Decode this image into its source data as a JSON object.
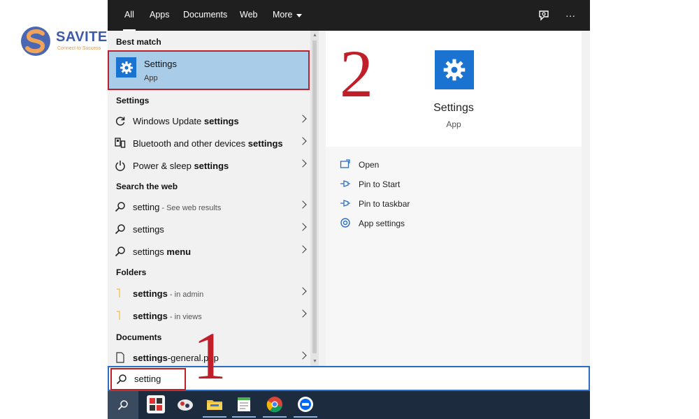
{
  "watermark": {
    "brand": "SAVITEL",
    "tagline": "Connect to Success"
  },
  "topbar": {
    "tabs": [
      {
        "label": "All",
        "active": true
      },
      {
        "label": "Apps",
        "active": false
      },
      {
        "label": "Documents",
        "active": false
      },
      {
        "label": "Web",
        "active": false
      },
      {
        "label": "More",
        "active": false
      }
    ],
    "more_dots": "···"
  },
  "left_pane": {
    "best_match_header": "Best match",
    "best_match": {
      "title": "Settings",
      "subtitle": "App"
    },
    "settings_header": "Settings",
    "settings_items": [
      {
        "prefix": "Windows Update ",
        "bold": "settings",
        "suffix": "",
        "icon": "sync-icon"
      },
      {
        "prefix": "Bluetooth and other devices ",
        "bold": "settings",
        "suffix": "",
        "icon": "devices-icon"
      },
      {
        "prefix": "Power & sleep ",
        "bold": "settings",
        "suffix": "",
        "icon": "power-icon"
      }
    ],
    "web_header": "Search the web",
    "web_items": [
      {
        "prefix": "setting",
        "bold": "",
        "suffix": " - See web results"
      },
      {
        "prefix": "settings",
        "bold": "",
        "suffix": ""
      },
      {
        "prefix": "settings ",
        "bold": "menu",
        "suffix": ""
      }
    ],
    "folders_header": "Folders",
    "folder_items": [
      {
        "bold": "settings",
        "suffix": " - in admin"
      },
      {
        "bold": "settings",
        "suffix": " - in views"
      }
    ],
    "documents_header": "Documents",
    "document_items": [
      {
        "bold": "settings",
        "suffix": "-general.php"
      }
    ]
  },
  "preview": {
    "title": "Settings",
    "subtitle": "App",
    "actions": [
      {
        "label": "Open",
        "icon": "open-icon"
      },
      {
        "label": "Pin to Start",
        "icon": "pin-icon"
      },
      {
        "label": "Pin to taskbar",
        "icon": "pin-icon"
      },
      {
        "label": "App settings",
        "icon": "gear-icon"
      }
    ]
  },
  "search": {
    "value": "setting"
  },
  "annotations": {
    "step1": "1",
    "step2": "2"
  },
  "colors": {
    "accent": "#1a73d0",
    "highlight": "#a9cde9",
    "annotation_red": "#c01f2a",
    "topbar": "#1f1f1f",
    "taskbar": "#1c2b3d"
  }
}
